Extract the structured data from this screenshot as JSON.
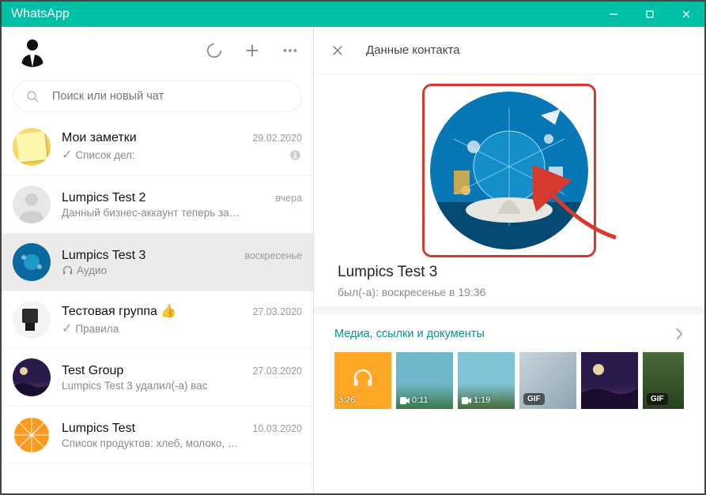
{
  "window": {
    "title": "WhatsApp"
  },
  "search": {
    "placeholder": "Поиск или новый чат"
  },
  "chats": [
    {
      "name": "Мои заметки",
      "time": "29.02.2020",
      "preview": "Список дел:",
      "tick": true,
      "pinned": true
    },
    {
      "name": "Lumpics Test 2",
      "time": "вчера",
      "preview": "Данный бизнес-аккаунт теперь за…"
    },
    {
      "name": "Lumpics Test 3",
      "time": "воскресенье",
      "preview": "Аудио",
      "audio": true,
      "selected": true
    },
    {
      "name": "Тестовая группа 👍",
      "time": "27.03.2020",
      "preview": "Правила",
      "tick": true
    },
    {
      "name": "Test Group",
      "time": "27.03.2020",
      "preview": "Lumpics Test 3 удалил(-а) вас"
    },
    {
      "name": "Lumpics Test",
      "time": "10.03.2020",
      "preview": "Список продуктов: хлеб, молоко, …"
    }
  ],
  "contactPanel": {
    "header": "Данные контакта",
    "name": "Lumpics Test 3",
    "status": "был(-а): воскресенье в 19:36",
    "mediaTitle": "Медиа, ссылки и документы",
    "media": [
      {
        "kind": "audio",
        "label": "3:26"
      },
      {
        "kind": "video",
        "label": "0:11"
      },
      {
        "kind": "video",
        "label": "1:19"
      },
      {
        "kind": "gif",
        "label": "GIF"
      },
      {
        "kind": "image",
        "label": ""
      },
      {
        "kind": "gif",
        "label": "GIF"
      }
    ]
  }
}
